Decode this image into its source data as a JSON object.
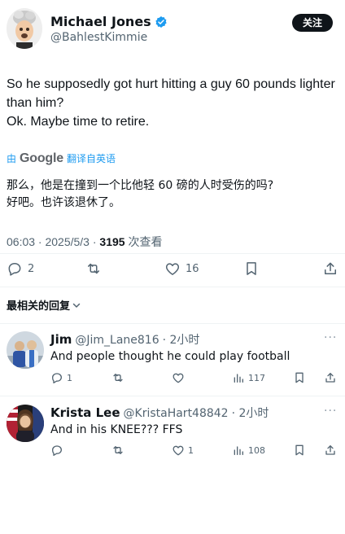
{
  "tweet": {
    "author_name": "Michael Jones",
    "author_handle": "@BahlestKimmie",
    "follow_label": "关注",
    "text_lines": [
      "So he supposedly got hurt hitting a guy 60 pounds lighter than him?",
      "Ok. Maybe time to retire."
    ],
    "translate": {
      "by": "由",
      "provider": "Google",
      "label": "翻译自英语"
    },
    "translated_lines": [
      "那么，他是在撞到一个比他轻 60 磅的人时受伤的吗?",
      "好吧。也许该退休了。"
    ],
    "time": "06:03 · 2025/5/3 · ",
    "views_count": "3195",
    "views_label": " 次查看",
    "actions": {
      "replies": "2",
      "retweets": "",
      "likes": "16"
    },
    "accent_color": "#1d9bf0"
  },
  "replies_section": {
    "label": "最相关的回复"
  },
  "replies": [
    {
      "name": "Jim",
      "handle": "@Jim_Lane816",
      "time": "· 2小时",
      "text": "And people thought he could play football",
      "more": "···",
      "replies": "1",
      "retweets": "",
      "likes": "",
      "views": "117"
    },
    {
      "name": "Krista Lee",
      "handle": "@KristaHart48842",
      "time": "· 2小时",
      "text": "And in his KNEE??? FFS",
      "more": "···",
      "replies": "",
      "retweets": "",
      "likes": "1",
      "views": "108"
    }
  ]
}
